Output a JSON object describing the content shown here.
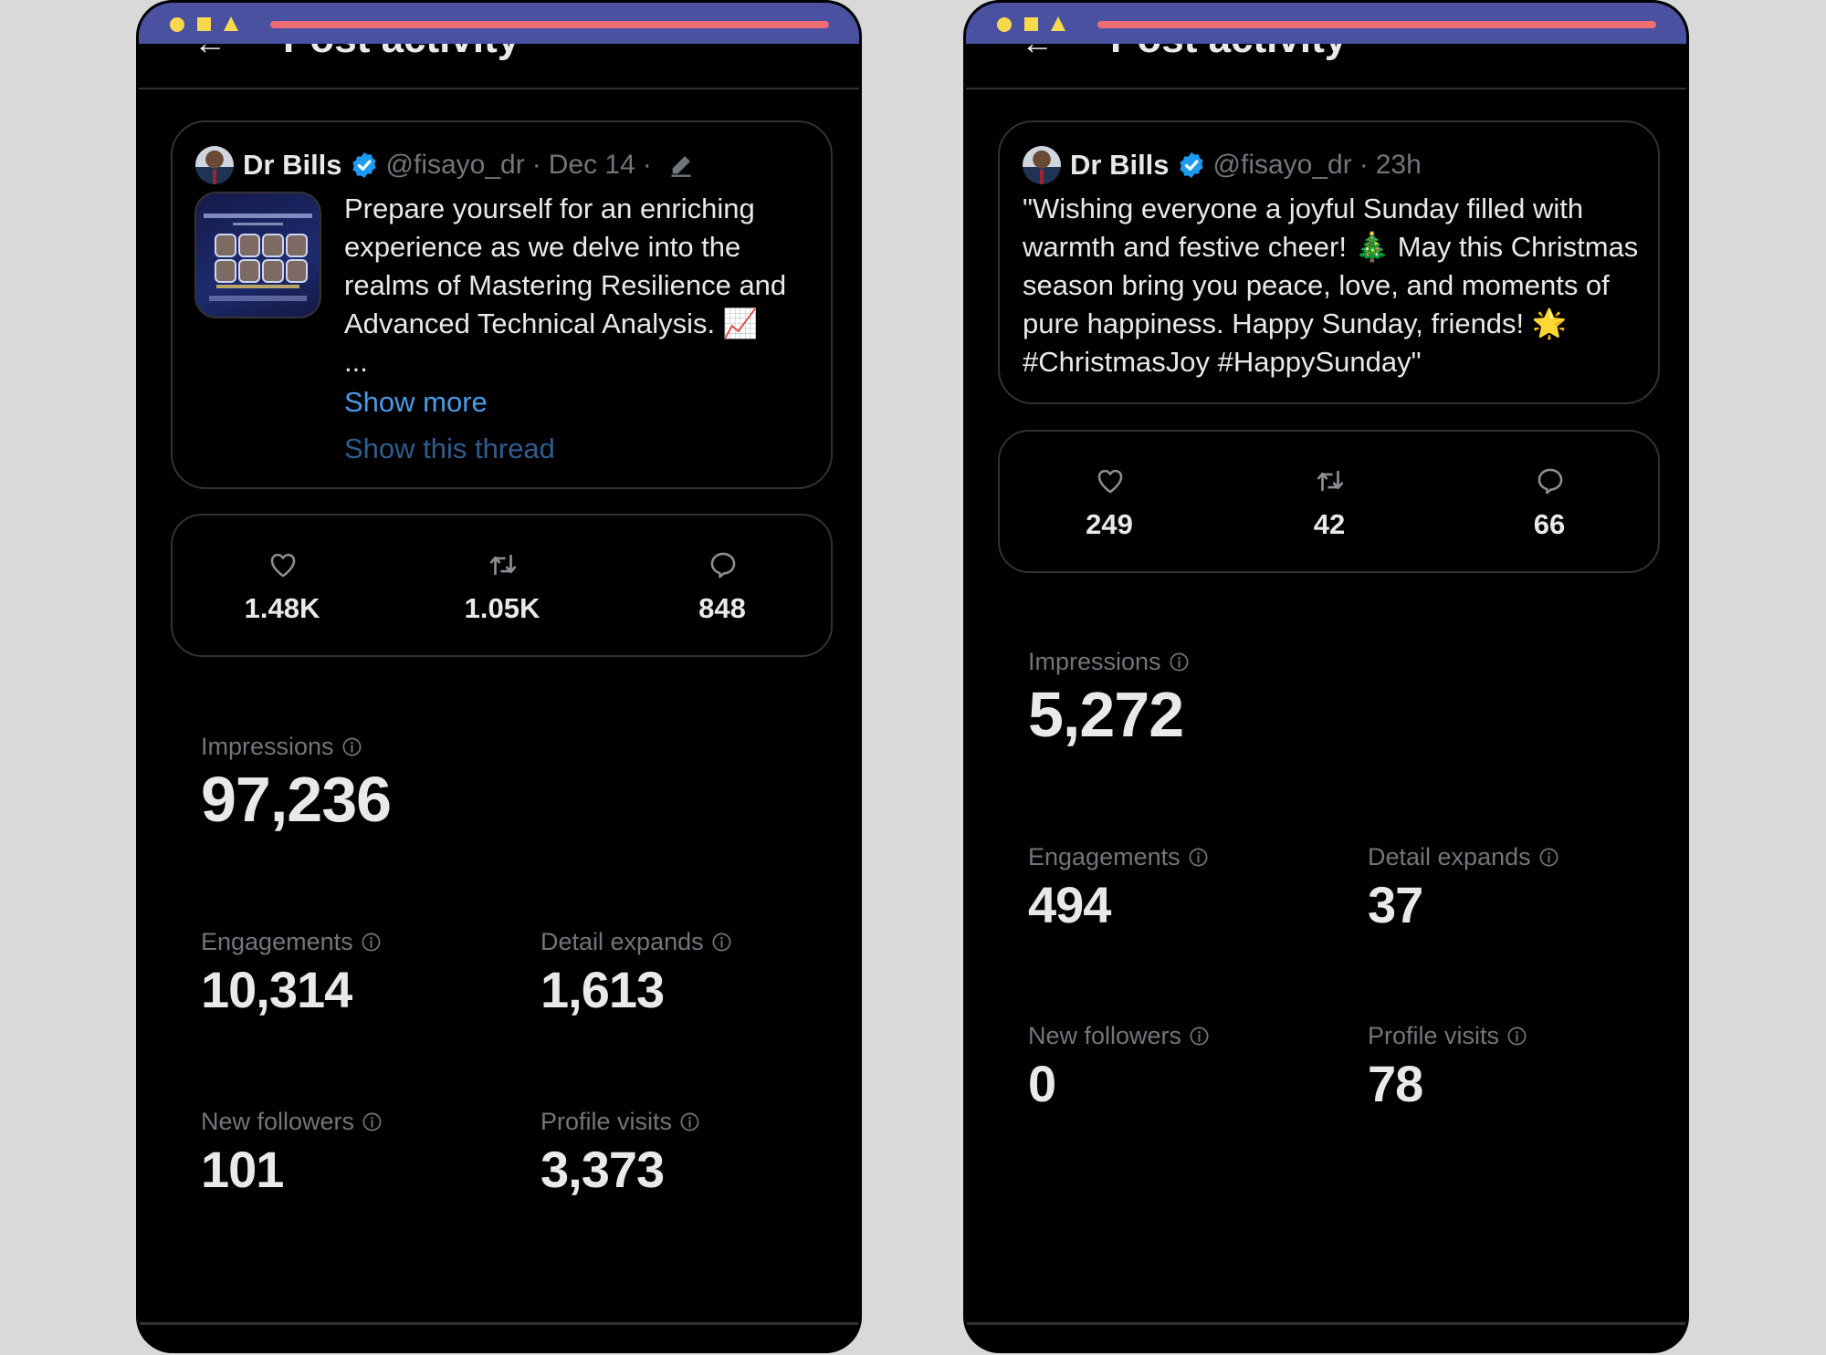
{
  "window_chrome": {
    "shape_icons": [
      "circle",
      "square",
      "triangle"
    ],
    "colors": {
      "titlebar": "#4a51a1",
      "shapes": "#f6d94c",
      "bar": "#ee6c74"
    }
  },
  "panels": [
    {
      "header": {
        "back_icon": "←",
        "title": "Post activity"
      },
      "tweet": {
        "author": "Dr Bills",
        "handle": "@fisayo_dr",
        "separator": "·",
        "timestamp": "Dec 14",
        "has_edit_icon": true,
        "text": "Prepare yourself for an enriching experience as we delve into the realms of Mastering Resilience and Advanced Technical Analysis. 📈",
        "ellipsis": "...",
        "show_more": "Show more",
        "show_thread": "Show this thread"
      },
      "engagement": [
        {
          "icon": "heart-icon",
          "value": "1.48K"
        },
        {
          "icon": "repost-icon",
          "value": "1.05K"
        },
        {
          "icon": "reply-icon",
          "value": "848"
        }
      ],
      "metrics": {
        "impressions": {
          "label": "Impressions",
          "value": "97,236"
        },
        "engagements": {
          "label": "Engagements",
          "value": "10,314"
        },
        "detail_expands": {
          "label": "Detail expands",
          "value": "1,613"
        },
        "new_followers": {
          "label": "New followers",
          "value": "101"
        },
        "profile_visits": {
          "label": "Profile visits",
          "value": "3,373"
        }
      }
    },
    {
      "header": {
        "back_icon": "←",
        "title": "Post activity"
      },
      "tweet": {
        "author": "Dr Bills",
        "handle": "@fisayo_dr",
        "separator": "·",
        "timestamp": "23h",
        "text": "\"Wishing everyone a joyful Sunday filled with warmth and festive cheer! 🎄 May this Christmas season bring you peace, love, and moments of pure happiness. Happy Sunday, friends! 🌟 #ChristmasJoy #HappySunday\""
      },
      "engagement": [
        {
          "icon": "heart-icon",
          "value": "249"
        },
        {
          "icon": "repost-icon",
          "value": "42"
        },
        {
          "icon": "reply-icon",
          "value": "66"
        }
      ],
      "metrics": {
        "impressions": {
          "label": "Impressions",
          "value": "5,272"
        },
        "engagements": {
          "label": "Engagements",
          "value": "494"
        },
        "detail_expands": {
          "label": "Detail expands",
          "value": "37"
        },
        "new_followers": {
          "label": "New followers",
          "value": "0"
        },
        "profile_visits": {
          "label": "Profile visits",
          "value": "78"
        }
      }
    }
  ]
}
